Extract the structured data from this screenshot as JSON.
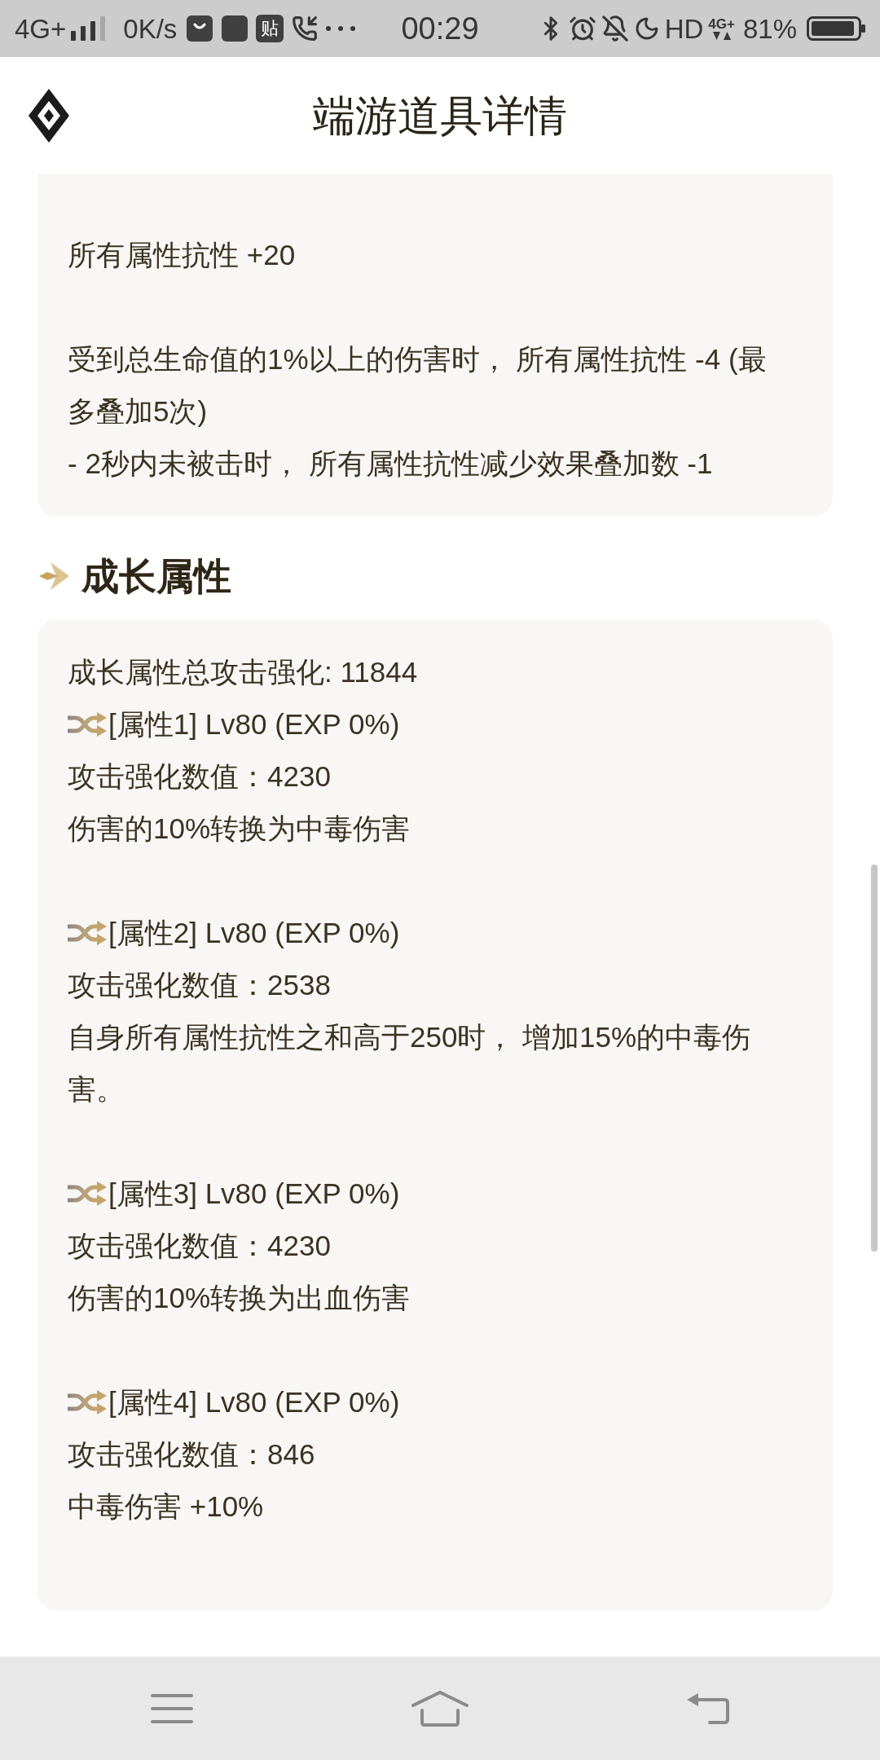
{
  "status_bar": {
    "network": "4G+",
    "speed": "0K/s",
    "app_badge": "贴",
    "time": "00:29",
    "hd": "HD",
    "data_network": "4G+",
    "battery": "81%"
  },
  "header": {
    "title": "端游道具详情"
  },
  "effects_card": {
    "paragraphs": [
      {
        "lines": [
          "所有属性抗性 +20"
        ]
      },
      {
        "lines": [
          "受到总生命值的1%以上的伤害时， 所有属性抗性 -4 (最多叠加5次)",
          "- 2秒内未被击时， 所有属性抗性减少效果叠加数 -1"
        ]
      }
    ]
  },
  "growth_section": {
    "title": "成长属性",
    "summary": "成长属性总攻击强化: 11844",
    "attributes": [
      {
        "name": "[属性1] Lv80 (EXP 0%)",
        "value": "攻击强化数值：4230",
        "effect": "伤害的10%转换为中毒伤害"
      },
      {
        "name": "[属性2] Lv80 (EXP 0%)",
        "value": "攻击强化数值：2538",
        "effect": "自身所有属性抗性之和高于250时， 增加15%的中毒伤害。"
      },
      {
        "name": "[属性3] Lv80 (EXP 0%)",
        "value": "攻击强化数值：4230",
        "effect": "伤害的10%转换为出血伤害"
      },
      {
        "name": "[属性4] Lv80 (EXP 0%)",
        "value": "攻击强化数值：846",
        "effect": "中毒伤害 +10%"
      }
    ]
  }
}
